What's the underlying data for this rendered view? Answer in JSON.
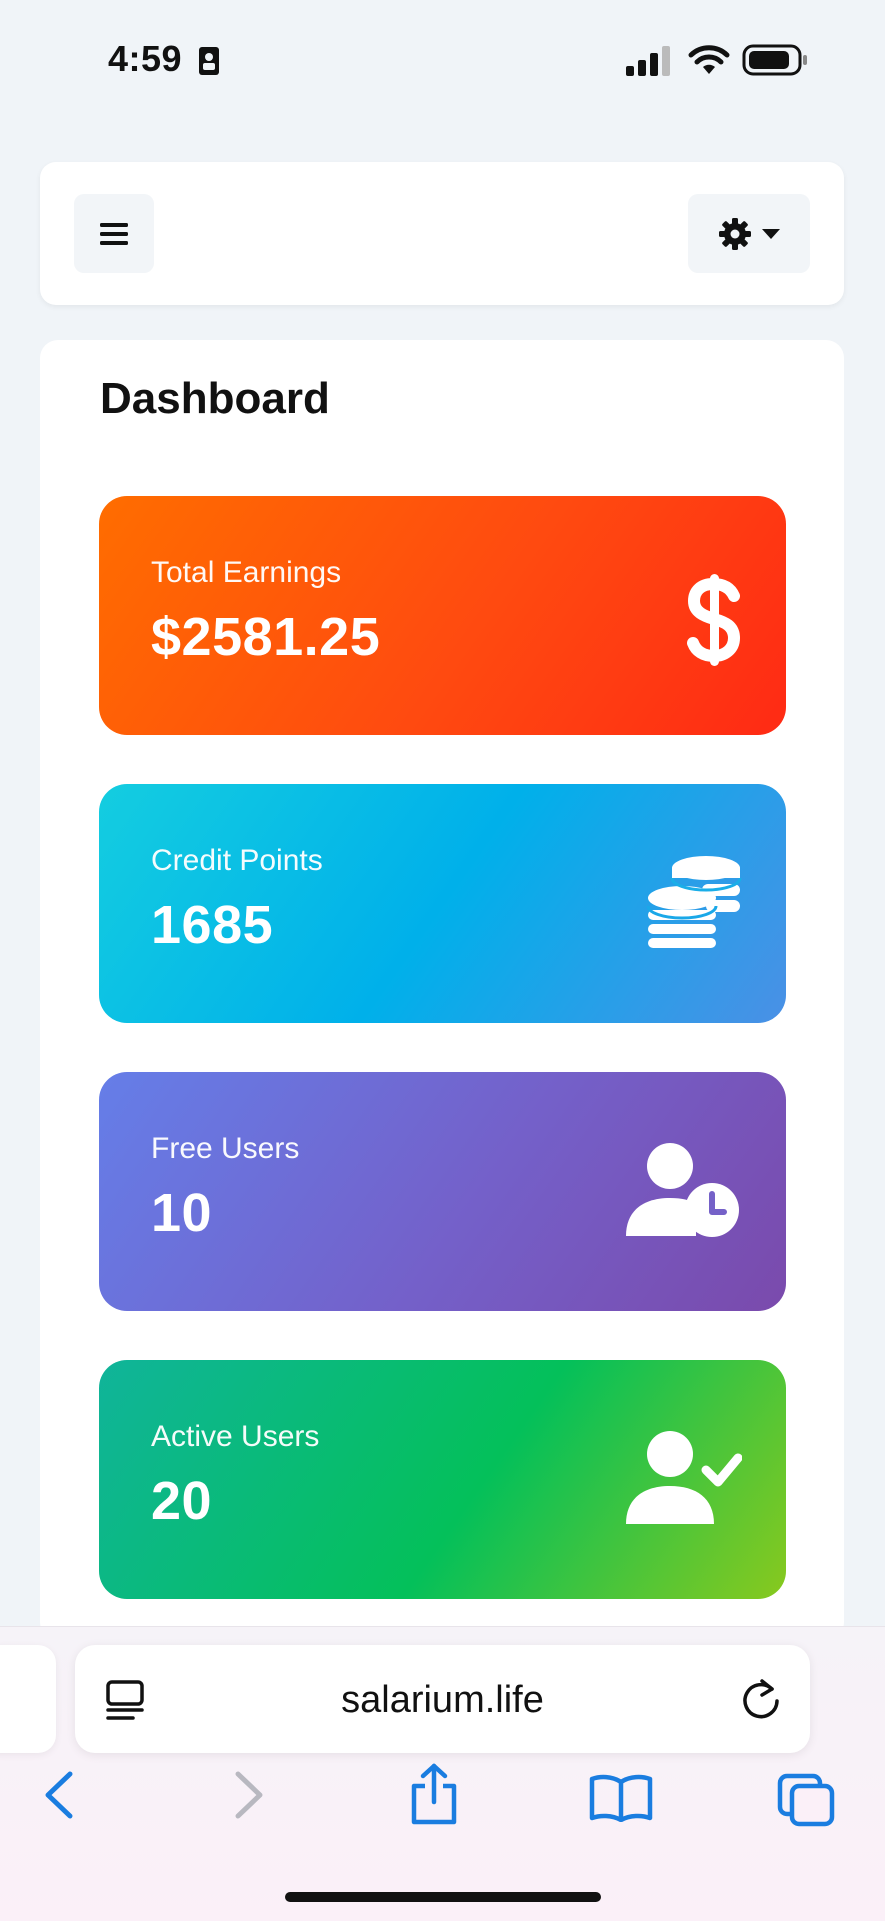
{
  "status_bar": {
    "time": "4:59"
  },
  "header": {
    "menu_icon": "hamburger-menu-icon",
    "settings_icon": "gear-icon"
  },
  "dashboard": {
    "title": "Dashboard",
    "cards": [
      {
        "label": "Total Earnings",
        "value": "$2581.25",
        "icon": "dollar-icon",
        "colors": [
          "#ff6d00",
          "#ff2a14"
        ]
      },
      {
        "label": "Credit Points",
        "value": "1685",
        "icon": "coins-icon",
        "colors": [
          "#14cde0",
          "#4a90e6"
        ]
      },
      {
        "label": "Free Users",
        "value": "10",
        "icon": "user-clock-icon",
        "colors": [
          "#657ee8",
          "#7a4aac"
        ]
      },
      {
        "label": "Active Users",
        "value": "20",
        "icon": "user-check-icon",
        "colors": [
          "#10b49a",
          "#88c91e"
        ]
      }
    ]
  },
  "browser": {
    "url": "salarium.life",
    "accent": "#1a7de0"
  }
}
